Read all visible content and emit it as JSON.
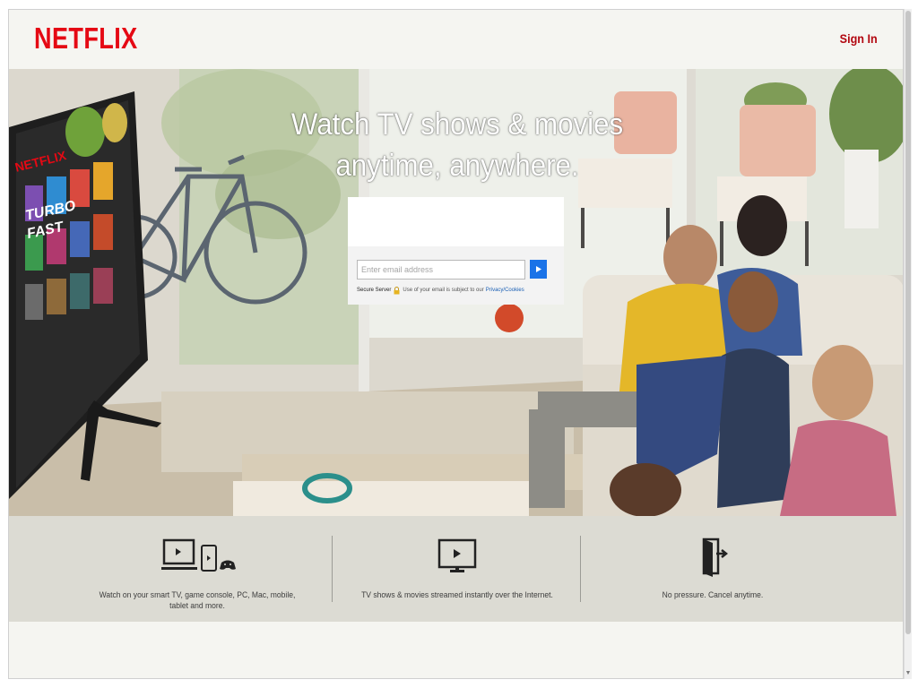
{
  "header": {
    "logo_text": "NETFLIX",
    "signin_label": "Sign In"
  },
  "hero": {
    "headline_line1": "Watch TV shows & movies",
    "headline_line2": "anytime, anywhere.",
    "tv_screen_text": {
      "brand": "NETFLIX",
      "title_line1": "TURBO",
      "title_line2": "FAST"
    }
  },
  "signup": {
    "email_placeholder": "Enter email address",
    "submit_icon": "play-arrow-icon",
    "secure_label": "Secure Server",
    "secure_icon": "lock-icon",
    "note": "Use of your email is subject to our",
    "privacy_link": "Privacy/Cookies"
  },
  "features": [
    {
      "icon": "devices-icon",
      "caption": "Watch on your smart TV, game console, PC, Mac, mobile, tablet and more."
    },
    {
      "icon": "monitor-play-icon",
      "caption": "TV shows & movies streamed instantly over the Internet."
    },
    {
      "icon": "cancel-door-icon",
      "caption": "No pressure. Cancel anytime."
    }
  ],
  "colors": {
    "brand_red": "#e50914",
    "signin_red": "#b20710",
    "submit_blue": "#1a73e8",
    "feature_band": "#dcdbd3",
    "page_bg": "#f5f5f1"
  }
}
